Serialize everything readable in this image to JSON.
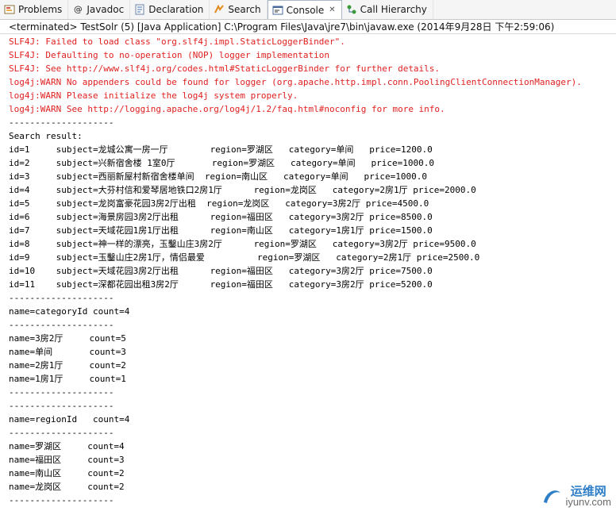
{
  "tabs": [
    {
      "label": "Problems",
      "icon": "problems-icon",
      "active": false
    },
    {
      "label": "Javadoc",
      "icon": "javadoc-icon",
      "active": false
    },
    {
      "label": "Declaration",
      "icon": "declaration-icon",
      "active": false
    },
    {
      "label": "Search",
      "icon": "search-icon",
      "active": false
    },
    {
      "label": "Console",
      "icon": "console-icon",
      "active": true
    },
    {
      "label": "Call Hierarchy",
      "icon": "call-hierarchy-icon",
      "active": false
    }
  ],
  "status_line": "<terminated> TestSolr (5) [Java Application] C:\\Program Files\\Java\\jre7\\bin\\javaw.exe (2014年9月28日 下午2:59:06)",
  "console_lines": [
    {
      "text": "SLF4J: Failed to load class \"org.slf4j.impl.StaticLoggerBinder\".",
      "error": true
    },
    {
      "text": "SLF4J: Defaulting to no-operation (NOP) logger implementation",
      "error": true
    },
    {
      "text": "SLF4J: See http://www.slf4j.org/codes.html#StaticLoggerBinder for further details.",
      "error": true
    },
    {
      "text": "log4j:WARN No appenders could be found for logger (org.apache.http.impl.conn.PoolingClientConnectionManager).",
      "error": true
    },
    {
      "text": "log4j:WARN Please initialize the log4j system properly.",
      "error": true
    },
    {
      "text": "log4j:WARN See http://logging.apache.org/log4j/1.2/faq.html#noconfig for more info.",
      "error": true
    },
    {
      "text": "--------------------",
      "error": false
    },
    {
      "text": "Search result:",
      "error": false
    },
    {
      "text": "id=1     subject=龙城公寓一房一厅        region=罗湖区   category=单间   price=1200.0",
      "error": false
    },
    {
      "text": "id=2     subject=兴新宿舍楼 1室0厅       region=罗湖区   category=单间   price=1000.0",
      "error": false
    },
    {
      "text": "id=3     subject=西丽新屋村新宿舍楼单间  region=南山区   category=单间   price=1000.0",
      "error": false
    },
    {
      "text": "id=4     subject=大芬村信和爱琴居地铁口2房1厅      region=龙岗区   category=2房1厅 price=2000.0",
      "error": false
    },
    {
      "text": "id=5     subject=龙岗富豪花园3房2厅出租  region=龙岗区   category=3房2厅 price=4500.0",
      "error": false
    },
    {
      "text": "id=6     subject=海景房园3房2厅出租      region=福田区   category=3房2厅 price=8500.0",
      "error": false
    },
    {
      "text": "id=7     subject=天域花园1房1厅出租      region=南山区   category=1房1厅 price=1500.0",
      "error": false
    },
    {
      "text": "id=8     subject=神一样的漂亮，玉鑿山庄3房2厅      region=罗湖区   category=3房2厅 price=9500.0",
      "error": false
    },
    {
      "text": "id=9     subject=玉鑿山庄2房1厅，情侣最爱          region=罗湖区   category=2房1厅 price=2500.0",
      "error": false
    },
    {
      "text": "id=10    subject=天域花园3房2厅出租      region=福田区   category=3房2厅 price=7500.0",
      "error": false
    },
    {
      "text": "id=11    subject=深都花园出租3房2厅      region=福田区   category=3房2厅 price=5200.0",
      "error": false
    },
    {
      "text": "--------------------",
      "error": false
    },
    {
      "text": "name=categoryId count=4",
      "error": false
    },
    {
      "text": "--------------------",
      "error": false
    },
    {
      "text": "name=3房2厅     count=5",
      "error": false
    },
    {
      "text": "name=单间       count=3",
      "error": false
    },
    {
      "text": "name=2房1厅     count=2",
      "error": false
    },
    {
      "text": "name=1房1厅     count=1",
      "error": false
    },
    {
      "text": "--------------------",
      "error": false
    },
    {
      "text": "--------------------",
      "error": false
    },
    {
      "text": "name=regionId   count=4",
      "error": false
    },
    {
      "text": "--------------------",
      "error": false
    },
    {
      "text": "name=罗湖区     count=4",
      "error": false
    },
    {
      "text": "name=福田区     count=3",
      "error": false
    },
    {
      "text": "name=南山区     count=2",
      "error": false
    },
    {
      "text": "name=龙岗区     count=2",
      "error": false
    },
    {
      "text": "--------------------",
      "error": false
    }
  ],
  "watermark": {
    "cn": "运维网",
    "en": "iyunv.com"
  }
}
